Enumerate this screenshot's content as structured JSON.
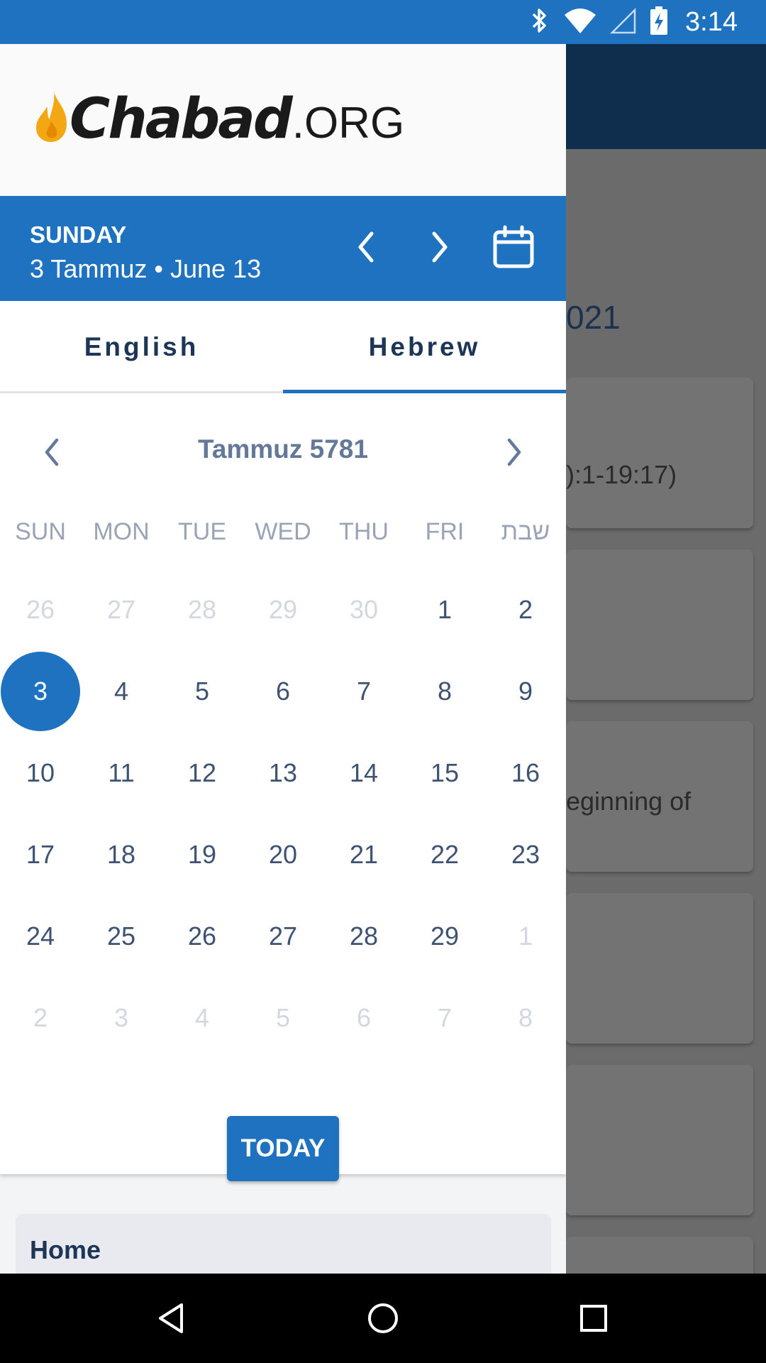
{
  "status_bar": {
    "time": "3:14",
    "icons": [
      "bluetooth-icon",
      "wifi-icon",
      "signal-icon",
      "battery-charging-icon"
    ]
  },
  "background_app": {
    "year_fragment": "021",
    "text_1": "):1-19:17)",
    "text_2": "eginning of"
  },
  "drawer": {
    "logo": {
      "word": "Chabad",
      "suffix": ".ORG",
      "flame_color": "#f3a712"
    },
    "date_bar": {
      "day_name": "SUNDAY",
      "date_line": "3 Tammuz • June 13"
    },
    "tabs": [
      {
        "label": "English",
        "active": false
      },
      {
        "label": "Hebrew",
        "active": true
      }
    ],
    "calendar": {
      "month_title": "Tammuz 5781",
      "weekdays": [
        "SUN",
        "MON",
        "TUE",
        "WED",
        "THU",
        "FRI",
        "שבת"
      ],
      "weeks": [
        [
          {
            "d": "26",
            "m": true
          },
          {
            "d": "27",
            "m": true
          },
          {
            "d": "28",
            "m": true
          },
          {
            "d": "29",
            "m": true
          },
          {
            "d": "30",
            "m": true
          },
          {
            "d": "1"
          },
          {
            "d": "2"
          }
        ],
        [
          {
            "d": "3",
            "sel": true
          },
          {
            "d": "4"
          },
          {
            "d": "5"
          },
          {
            "d": "6"
          },
          {
            "d": "7"
          },
          {
            "d": "8"
          },
          {
            "d": "9"
          }
        ],
        [
          {
            "d": "10"
          },
          {
            "d": "11"
          },
          {
            "d": "12"
          },
          {
            "d": "13"
          },
          {
            "d": "14"
          },
          {
            "d": "15"
          },
          {
            "d": "16"
          }
        ],
        [
          {
            "d": "17"
          },
          {
            "d": "18"
          },
          {
            "d": "19"
          },
          {
            "d": "20"
          },
          {
            "d": "21"
          },
          {
            "d": "22"
          },
          {
            "d": "23"
          }
        ],
        [
          {
            "d": "24"
          },
          {
            "d": "25"
          },
          {
            "d": "26"
          },
          {
            "d": "27"
          },
          {
            "d": "28"
          },
          {
            "d": "29"
          },
          {
            "d": "1",
            "m": true
          }
        ],
        [
          {
            "d": "2",
            "m": true
          },
          {
            "d": "3",
            "m": true
          },
          {
            "d": "4",
            "m": true
          },
          {
            "d": "5",
            "m": true
          },
          {
            "d": "6",
            "m": true
          },
          {
            "d": "7",
            "m": true
          },
          {
            "d": "8",
            "m": true
          }
        ]
      ],
      "today_label": "TODAY"
    },
    "menu": {
      "home_label": "Home"
    }
  },
  "colors": {
    "accent": "#1e72bf",
    "header_dark": "#0f2d4d",
    "text_dark": "#1d3557",
    "muted_day": "#d3d7de"
  }
}
